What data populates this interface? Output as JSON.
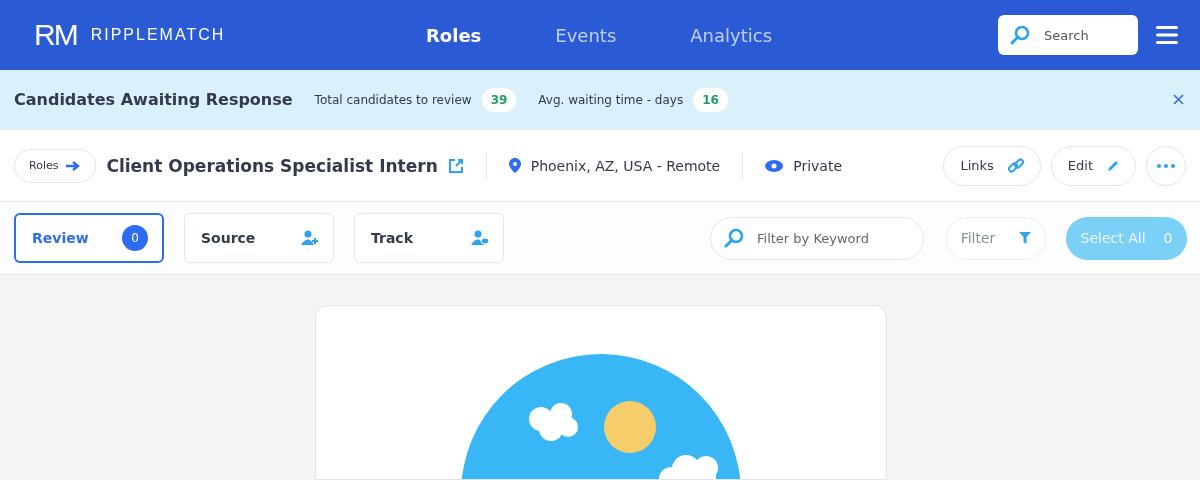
{
  "header": {
    "logo_mark": "RM",
    "logo_text": "RIPPLEMATCH",
    "nav": [
      {
        "label": "Roles",
        "selected": true
      },
      {
        "label": "Events",
        "selected": false
      },
      {
        "label": "Analytics",
        "selected": false
      }
    ],
    "search": {
      "placeholder": "Search"
    }
  },
  "banner": {
    "title": "Candidates Awaiting Response",
    "stats": [
      {
        "label": "Total candidates to review",
        "value": "39"
      },
      {
        "label": "Avg. waiting time - days",
        "value": "16"
      }
    ]
  },
  "role": {
    "breadcrumb": "Roles",
    "title": "Client Operations Specialist Intern",
    "location": "Phoenix, AZ, USA - Remote",
    "visibility": "Private",
    "actions": [
      {
        "label": "Links",
        "kind": "link"
      },
      {
        "label": "Edit",
        "kind": "edit"
      }
    ]
  },
  "tabs": [
    {
      "label": "Review",
      "selected": true,
      "count": "0",
      "kind": "count"
    },
    {
      "label": "Source",
      "selected": false,
      "kind": "add-person"
    },
    {
      "label": "Track",
      "selected": false,
      "kind": "watch-person"
    }
  ],
  "filter": {
    "placeholder": "Filter by Keyword",
    "button": "Filter",
    "select_all": "Select All",
    "select_count": "0"
  }
}
